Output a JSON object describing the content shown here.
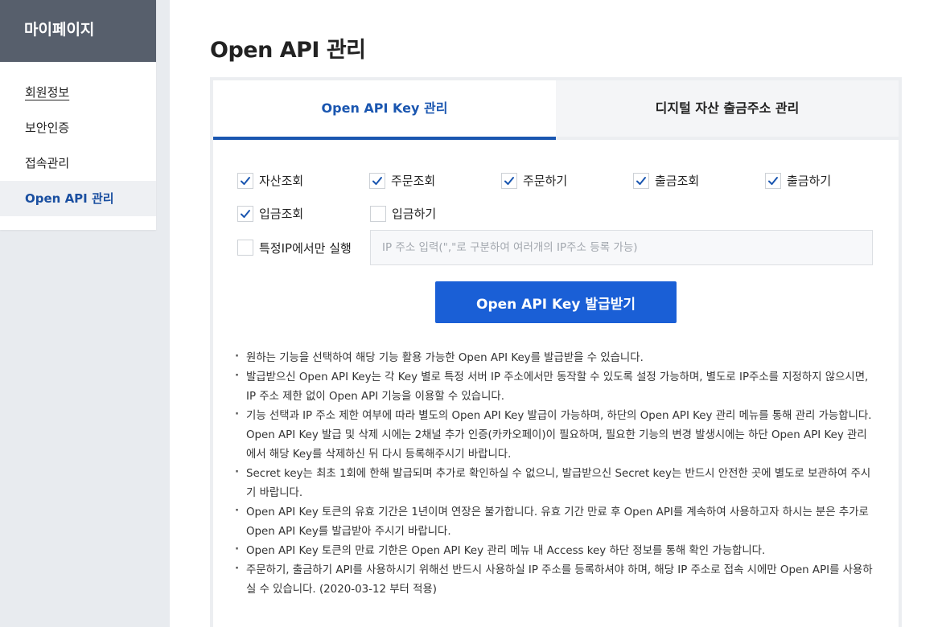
{
  "sidebar": {
    "title": "마이페이지",
    "items": [
      {
        "label": "회원정보"
      },
      {
        "label": "보안인증"
      },
      {
        "label": "접속관리"
      },
      {
        "label": "Open API 관리"
      }
    ]
  },
  "main": {
    "title": "Open API 관리",
    "tabs": [
      {
        "label": "Open API Key 관리"
      },
      {
        "label": "디지털 자산 출금주소 관리"
      }
    ]
  },
  "permissions": [
    {
      "label": "자산조회",
      "checked": true
    },
    {
      "label": "주문조회",
      "checked": true
    },
    {
      "label": "주문하기",
      "checked": true
    },
    {
      "label": "출금조회",
      "checked": true
    },
    {
      "label": "출금하기",
      "checked": true
    },
    {
      "label": "입금조회",
      "checked": true
    },
    {
      "label": "입금하기",
      "checked": false
    }
  ],
  "ip_restriction": {
    "label": "특정IP에서만 실행",
    "checked": false,
    "placeholder": "IP 주소 입력(\",\"로 구분하여 여러개의 IP주소 등록 가능)",
    "value": ""
  },
  "issue_button": {
    "label": "Open API Key 발급받기"
  },
  "notes": [
    "원하는 기능을 선택하여 해당 기능 활용 가능한 Open API Key를 발급받을 수 있습니다.",
    "발급받으신 Open API Key는 각 Key 별로 특정 서버 IP 주소에서만 동작할 수 있도록 설정 가능하며, 별도로 IP주소를 지정하지 않으시면, IP 주소 제한 없이 Open API 기능을 이용할 수 있습니다.",
    "기능 선택과 IP 주소 제한 여부에 따라 별도의 Open API Key 발급이 가능하며, 하단의 Open API Key 관리 메뉴를 통해 관리 가능합니다. Open API Key 발급 및 삭제 시에는 2채널 추가 인증(카카오페이)이 필요하며, 필요한 기능의 변경 발생시에는 하단 Open API Key 관리에서 해당 Key를 삭제하신 뒤 다시 등록해주시기 바랍니다.",
    "Secret key는 최초 1회에 한해 발급되며 추가로 확인하실 수 없으니, 발급받으신 Secret key는 반드시 안전한 곳에 별도로 보관하여 주시기 바랍니다.",
    "Open API Key 토큰의 유효 기간은 1년이며 연장은 불가합니다. 유효 기간 만료 후 Open API를 계속하여 사용하고자 하시는 분은 추가로 Open API Key를 발급받아 주시기 바랍니다.",
    "Open API Key 토큰의 만료 기한은 Open API Key 관리 메뉴 내 Access key 하단 정보를 통해 확인 가능합니다.",
    "주문하기, 출금하기 API를 사용하시기 위해선 반드시 사용하실 IP 주소를 등록하셔야 하며, 해당 IP 주소로 접속 시에만 Open API를 사용하실 수 있습니다. (2020-03-12 부터 적용)"
  ],
  "colors": {
    "accent": "#1a56b0",
    "button": "#1a5fd6",
    "sidebar_header": "#575f6c"
  }
}
